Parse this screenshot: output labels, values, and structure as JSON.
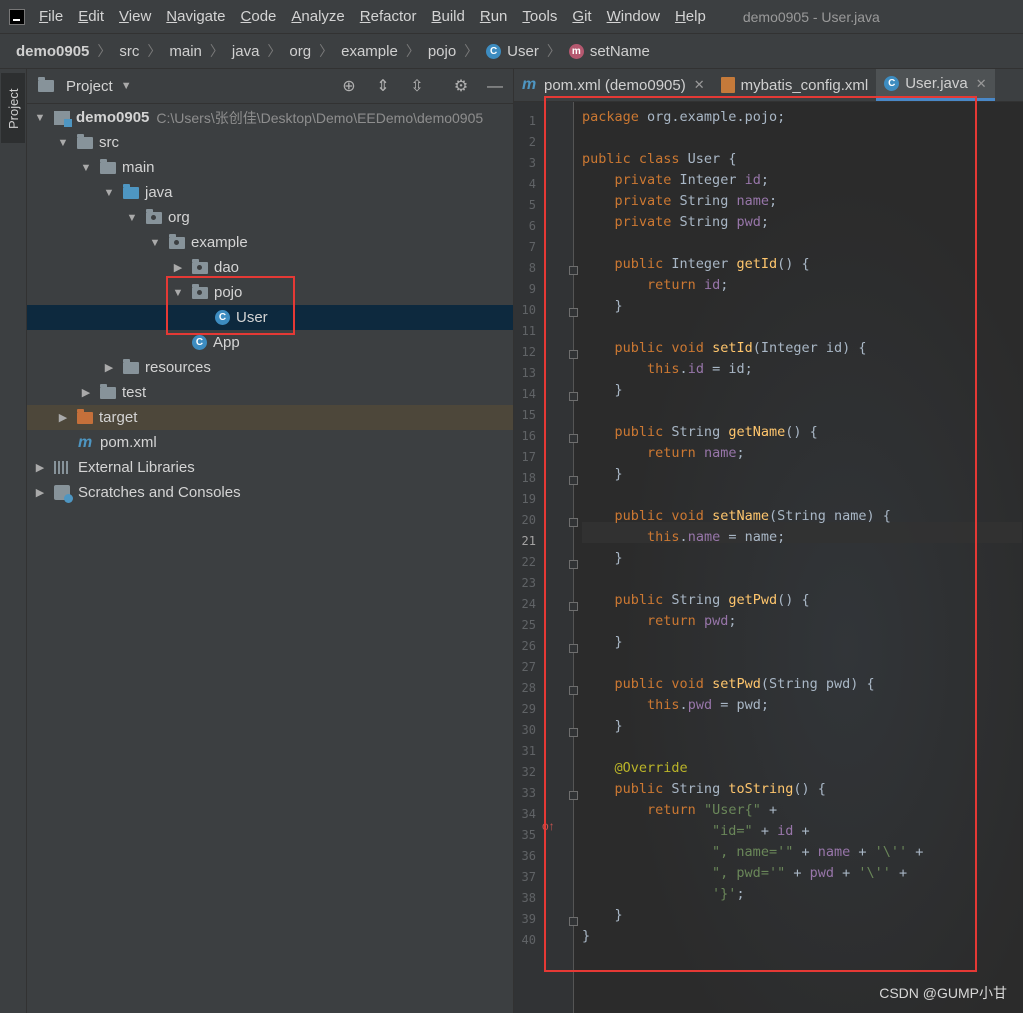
{
  "menu": {
    "items": [
      "File",
      "Edit",
      "View",
      "Navigate",
      "Code",
      "Analyze",
      "Refactor",
      "Build",
      "Run",
      "Tools",
      "Git",
      "Window",
      "Help"
    ],
    "window_title": "demo0905 - User.java"
  },
  "breadcrumb": {
    "items": [
      "demo0905",
      "src",
      "main",
      "java",
      "org",
      "example",
      "pojo",
      "User",
      "setName"
    ]
  },
  "sidebar_stripe": {
    "label": "Project"
  },
  "project_panel": {
    "title": "Project",
    "tree": [
      {
        "label": "demo0905",
        "path": "C:\\Users\\张创佳\\Desktop\\Demo\\EEDemo\\demo0905"
      },
      {
        "label": "src"
      },
      {
        "label": "main"
      },
      {
        "label": "java"
      },
      {
        "label": "org"
      },
      {
        "label": "example"
      },
      {
        "label": "dao"
      },
      {
        "label": "pojo"
      },
      {
        "label": "User"
      },
      {
        "label": "App"
      },
      {
        "label": "resources"
      },
      {
        "label": "test"
      },
      {
        "label": "target"
      },
      {
        "label": "pom.xml"
      },
      {
        "label": "External Libraries"
      },
      {
        "label": "Scratches and Consoles"
      }
    ]
  },
  "editor": {
    "tabs": [
      {
        "label": "pom.xml (demo0905)",
        "icon": "maven-icon",
        "active": false
      },
      {
        "label": "mybatis_config.xml",
        "icon": "xml-icon",
        "active": false
      },
      {
        "label": "User.java",
        "icon": "class-icon",
        "active": true
      }
    ],
    "current_line": 21,
    "line_count": 40
  },
  "watermark": "CSDN @GUMP小甘",
  "colors": {
    "keyword": "#cc7832",
    "field": "#9876aa",
    "method": "#ffc66d",
    "string": "#6a8759",
    "annotation": "#bbb529",
    "highlight_box": "#e53935",
    "selection": "#0d293e"
  }
}
